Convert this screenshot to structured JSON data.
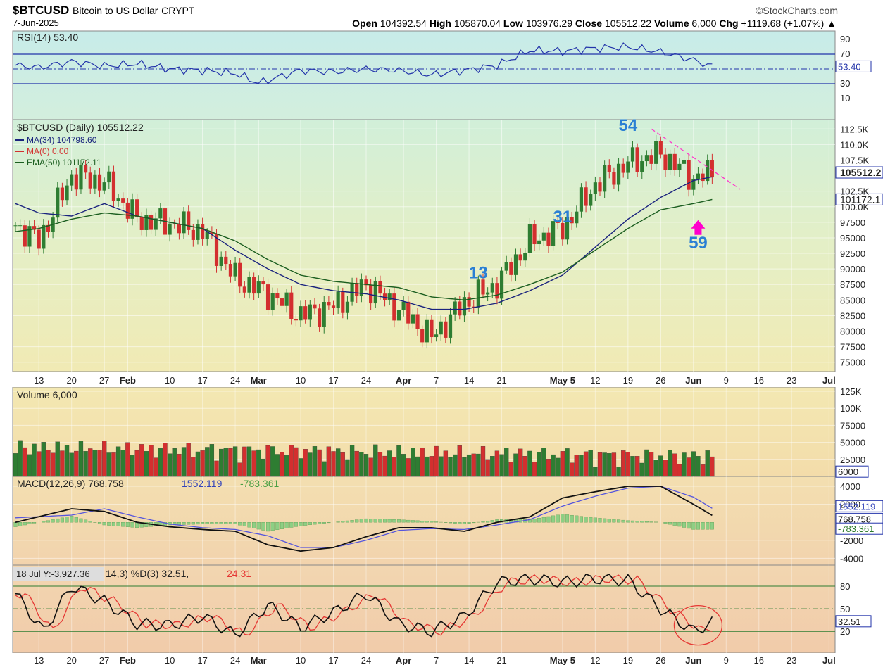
{
  "header": {
    "symbol": "$BTCUSD",
    "name": "Bitcoin to US Dollar",
    "exchange": "CRYPT",
    "date": "7-Jun-2025",
    "source": "©StockCharts.com",
    "open_label": "Open",
    "open": "104392.54",
    "high_label": "High",
    "high": "105870.04",
    "low_label": "Low",
    "low": "103976.29",
    "close_label": "Close",
    "close": "105512.22",
    "volume_label": "Volume",
    "volume": "6,000",
    "chg_label": "Chg",
    "chg": "+1119.68 (+1.07%)"
  },
  "colors": {
    "up": "#2e7d32",
    "down": "#d32f2f",
    "ma34": "#1a237e",
    "ema50": "#1b5e20",
    "trend": "#ff33cc",
    "arrow": "#ff00cc",
    "label": "#2a7fd4",
    "frame": "#2233aa"
  },
  "chart_data": [
    {
      "type": "line",
      "panel": "rsi",
      "title": "RSI(14) 53.40",
      "x": [
        "Jan 8",
        "Jan 13",
        "Jan 20",
        "Jan 27",
        "Feb 3",
        "Feb 10",
        "Feb 17",
        "Feb 24",
        "Mar 3",
        "Mar 10",
        "Mar 17",
        "Mar 24",
        "Mar 31",
        "Apr 7",
        "Apr 14",
        "Apr 21",
        "Apr 28",
        "May 5",
        "May 12",
        "May 19",
        "May 26",
        "Jun 2",
        "Jun 7"
      ],
      "series": [
        {
          "name": "RSI(14)",
          "values": [
            55,
            52,
            60,
            54,
            57,
            50,
            48,
            44,
            31,
            48,
            46,
            50,
            48,
            42,
            48,
            55,
            75,
            74,
            78,
            80,
            73,
            62,
            53.4
          ]
        }
      ],
      "levels": [
        70,
        50,
        30
      ],
      "ylim": [
        0,
        100
      ],
      "yticks": [
        "90",
        "70",
        "30",
        "10"
      ],
      "last_label": "53.40"
    },
    {
      "type": "candlestick",
      "panel": "price",
      "title": "$BTCUSD (Daily) 105512.22",
      "legend": [
        "MA(34) 104798.60",
        "MA(0) 0.00",
        "EMA(50) 101172.11"
      ],
      "ylim": [
        73500,
        114000
      ],
      "yticks": [
        "112.5K",
        "110.0K",
        "107.5K",
        "105512.2",
        "102.5K",
        "101172.1",
        "100.0K",
        "97500",
        "95000",
        "92500",
        "90000",
        "87500",
        "85000",
        "82500",
        "80000",
        "77500",
        "75000"
      ],
      "x": [
        "Jan 8",
        "Jan 13",
        "Jan 20",
        "Jan 27",
        "Feb 3",
        "Feb 10",
        "Feb 17",
        "Feb 24",
        "Mar 3",
        "Mar 10",
        "Mar 17",
        "Mar 24",
        "Mar 31",
        "Apr 7",
        "Apr 14",
        "Apr 21",
        "Apr 28",
        "May 5",
        "May 12",
        "May 19",
        "May 26",
        "Jun 2",
        "Jun 7"
      ],
      "close": [
        97000,
        94500,
        105000,
        104000,
        98000,
        97300,
        96000,
        88500,
        86000,
        82500,
        84000,
        87500,
        83500,
        79000,
        84500,
        87500,
        94500,
        96500,
        103500,
        107000,
        108500,
        104500,
        105512
      ],
      "ma34": [
        100500,
        99000,
        98500,
        100500,
        98500,
        97500,
        96500,
        93000,
        90000,
        87500,
        86500,
        86000,
        85000,
        83500,
        83500,
        84500,
        86500,
        89000,
        93500,
        98000,
        101500,
        104200,
        104800
      ],
      "ema50": [
        96000,
        96500,
        98000,
        99000,
        98500,
        97500,
        96500,
        94500,
        91500,
        89000,
        88000,
        87500,
        87000,
        85500,
        85000,
        85800,
        87500,
        89500,
        93000,
        96500,
        99500,
        100500,
        101172
      ],
      "annotations": [
        "13",
        "31",
        "54",
        "59"
      ],
      "trendline": {
        "from": [
          "May 22",
          112500
        ],
        "to": [
          "Jun 12",
          102800
        ]
      }
    },
    {
      "type": "bar",
      "panel": "volume",
      "title": "Volume 6,000",
      "yticks": [
        "125K",
        "100K",
        "75000",
        "50000",
        "25000",
        "6000"
      ],
      "ylim": [
        0,
        125000
      ]
    },
    {
      "type": "line",
      "panel": "macd",
      "title": "MACD(12,26,9)",
      "values": [
        "768.758",
        "1552.119",
        "-783.361"
      ],
      "yticks": [
        "4000",
        "2000",
        "-2000",
        "-4000"
      ],
      "last_labels": [
        "1552.119",
        "768.758",
        "-783.361"
      ]
    },
    {
      "type": "line",
      "panel": "stoch",
      "title": "%D(3) 32.51,",
      "tooltip": "18 Jul Y:-3,927.36",
      "tooltip_tail": "14,3)",
      "value_d": "24.31",
      "yticks": [
        "80",
        "50",
        "20"
      ],
      "last_label": "32.51",
      "ylim": [
        0,
        100
      ]
    }
  ],
  "xaxis_labels": [
    "13",
    "20",
    "27",
    "Feb",
    "10",
    "17",
    "24",
    "Mar",
    "10",
    "17",
    "24",
    "Apr",
    "7",
    "14",
    "21",
    "May 5",
    "12",
    "19",
    "26",
    "Jun",
    "9",
    "16",
    "23",
    "Jul"
  ]
}
